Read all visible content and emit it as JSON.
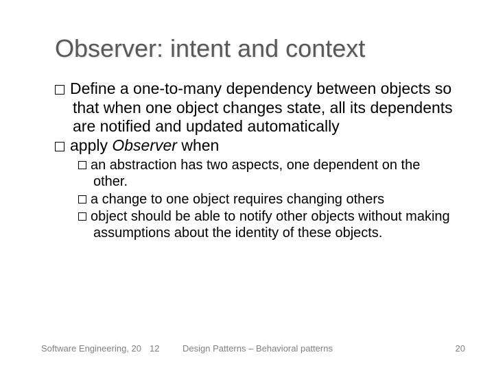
{
  "slide": {
    "title": "Observer: intent and context",
    "bullets": [
      {
        "text": "Define a one-to-many dependency between objects so that when one object changes state, all its dependents are notified and updated automatically"
      },
      {
        "prefix": "apply ",
        "italic": "Observer",
        "suffix": " when"
      }
    ],
    "sub_bullets": [
      "an abstraction has two aspects, one dependent on the other.",
      "a change to one object requires changing others",
      "object should be able to notify other objects without making assumptions about the identity of these objects."
    ]
  },
  "footer": {
    "left": "Software Engineering, 20",
    "mid1": "12",
    "mid2": "Design Patterns – Behavioral patterns",
    "right": "20"
  }
}
